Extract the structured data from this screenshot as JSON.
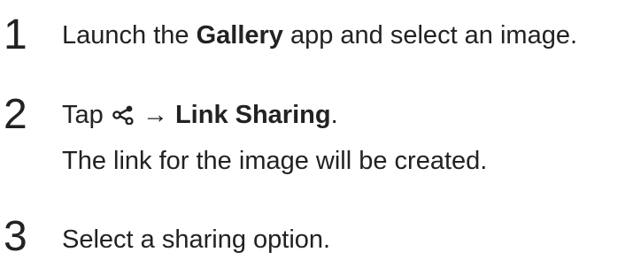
{
  "steps": [
    {
      "number": "1",
      "pre": "Launch the ",
      "bold": "Gallery",
      "post": " app and select an image."
    },
    {
      "number": "2",
      "pre": "Tap ",
      "icon": "share-icon",
      "arrow": "→",
      "bold": "Link Sharing",
      "post": ".",
      "note": "The link for the image will be created."
    },
    {
      "number": "3",
      "text": "Select a sharing option."
    }
  ]
}
